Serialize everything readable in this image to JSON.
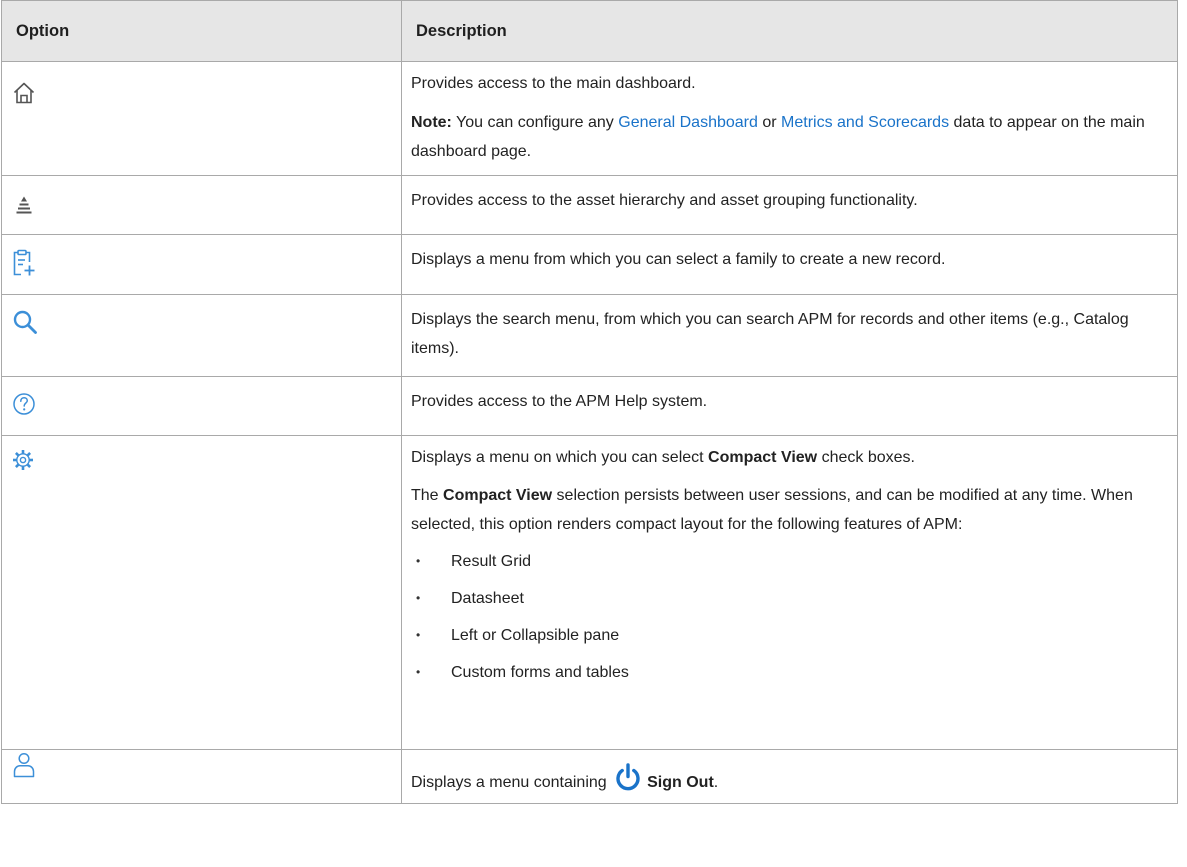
{
  "table": {
    "header": {
      "option": "Option",
      "description": "Description"
    },
    "rows": {
      "home": {
        "icon": "home-icon",
        "description": "Provides access to the main dashboard.",
        "note_label": "Note:",
        "note_text_1": " You can configure any ",
        "note_link_1": "General Dashboard",
        "note_text_2": " or ",
        "note_link_2": "Metrics and Scorecards",
        "note_text_3": " data to appear on the main dashboard page."
      },
      "hierarchy": {
        "icon": "asset-hierarchy-icon",
        "description": "Provides access to the asset hierarchy and asset grouping functionality."
      },
      "new_record": {
        "icon": "new-record-icon",
        "description": "Displays a menu from which you can select a family to create a new record."
      },
      "search": {
        "icon": "search-icon",
        "description": "Displays the search menu, from which you can search APM for records and other items (e.g., Catalog items)."
      },
      "help": {
        "icon": "help-icon",
        "description": "Provides access to the APM Help system."
      },
      "settings": {
        "icon": "gear-icon",
        "line1_pre": "Displays a menu on which you can select ",
        "line1_bold": "Compact View",
        "line1_post": " check boxes.",
        "para2_pre": "The ",
        "para2_bold": "Compact View",
        "para2_post": " selection persists between user sessions, and can be modified at any time. When selected, this option renders compact layout for the following features of APM:",
        "features": [
          "Result Grid",
          "Datasheet",
          "Left or Collapsible pane",
          "Custom forms and tables"
        ]
      },
      "user": {
        "icon": "user-icon",
        "text_pre": "Displays a menu containing ",
        "power_icon": "power-icon",
        "bold": "Sign Out",
        "text_post": "."
      }
    }
  },
  "colors": {
    "link": "#1a73c9",
    "icon_blue": "#3c8fd8",
    "icon_gray": "#555555",
    "header_bg": "#e6e6e6",
    "border": "#a9a9a9"
  }
}
